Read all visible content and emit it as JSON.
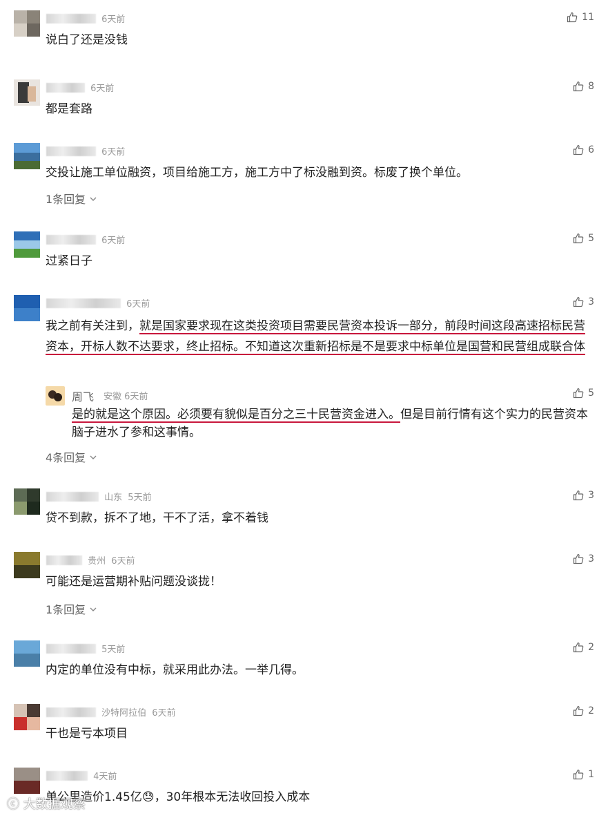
{
  "comments": [
    {
      "location": "",
      "time": "6天前",
      "text": "说白了还是没钱",
      "likes": "11",
      "replies": ""
    },
    {
      "location": "",
      "time": "6天前",
      "text": "都是套路",
      "likes": "8",
      "replies": ""
    },
    {
      "location": "",
      "time": "6天前",
      "text": "交投让施工单位融资，项目给施工方，施工方中了标没融到资。标废了换个单位。",
      "likes": "6",
      "replies": "1条回复"
    },
    {
      "location": "",
      "time": "6天前",
      "text": "过紧日子",
      "likes": "5",
      "replies": ""
    },
    {
      "location": "",
      "time": "6天前",
      "text_plain_before": "我之前有关注到，",
      "text_underlined": "就是国家要求现在这类投资项目需要民营资本投诉一部分，前段时间这段高速招标民营资本，开标人数不达要求，终止招标。不知道这次重新招标是不是要求中标单位是国营和民营组成联合体",
      "likes": "3",
      "replies": "4条回复"
    },
    {
      "location": "山东",
      "time": "5天前",
      "text": "贷不到款，拆不了地，干不了活，拿不着钱",
      "likes": "3",
      "replies": ""
    },
    {
      "location": "贵州",
      "time": "6天前",
      "text": "可能还是运营期补贴问题没谈拢！",
      "likes": "3",
      "replies": "1条回复"
    },
    {
      "location": "",
      "time": "5天前",
      "text": "内定的单位没有中标，就采用此办法。一举几得。",
      "likes": "2",
      "replies": ""
    },
    {
      "location": "沙特阿拉伯",
      "time": "6天前",
      "text": "干也是亏本项目",
      "likes": "2",
      "replies": ""
    },
    {
      "location": "",
      "time": "4天前",
      "text_before": "单公里造价1.45亿",
      "emoji": "😓",
      "text_after": "，30年根本无法收回投入成本",
      "likes": "1",
      "replies": ""
    }
  ],
  "reply": {
    "name": "周飞",
    "location": "安徽",
    "time": "6天前",
    "text_underlined": "是的就是这个原因。必须要有貌似是百分之三十民营资金进入。",
    "text_after": "但是目前行情有这个实力的民营资本脑子进水了参和这事情。",
    "likes": "5"
  },
  "watermark": "大数据观察",
  "icons": {
    "like": "thumbs-up-icon",
    "expand": "chevron-down-icon"
  }
}
